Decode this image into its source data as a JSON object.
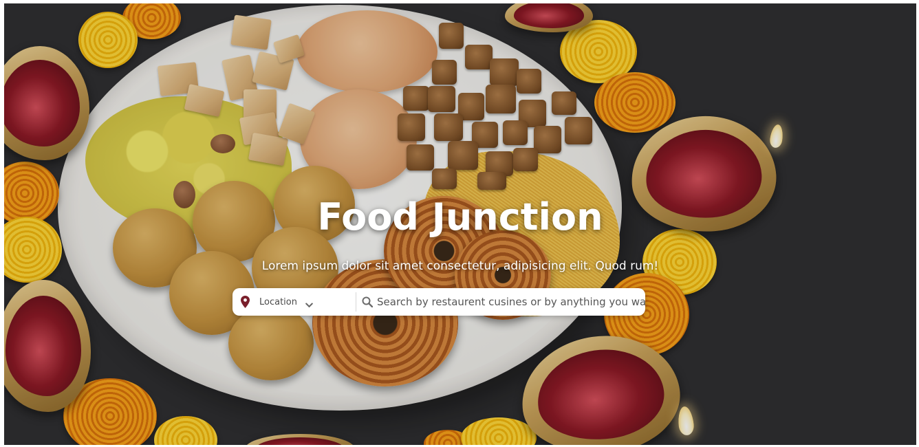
{
  "hero": {
    "title": "Food Junction",
    "subtitle": "Lorem ipsum dolor sit amet consectetur, adipisicing elit. Quod rum!",
    "background_image": "diwali-sweets-plate"
  },
  "search": {
    "location_label": "Location",
    "location_icon": "map-pin-icon",
    "dropdown_icon": "chevron-down-icon",
    "search_icon": "search-icon",
    "placeholder": "Search by restaurent cusines or by anything you want",
    "value": ""
  },
  "colors": {
    "pin": "#7a1f2b",
    "search_icon": "#6b6b6b",
    "bar_bg": "#ffffff",
    "text": "#ffffff"
  }
}
